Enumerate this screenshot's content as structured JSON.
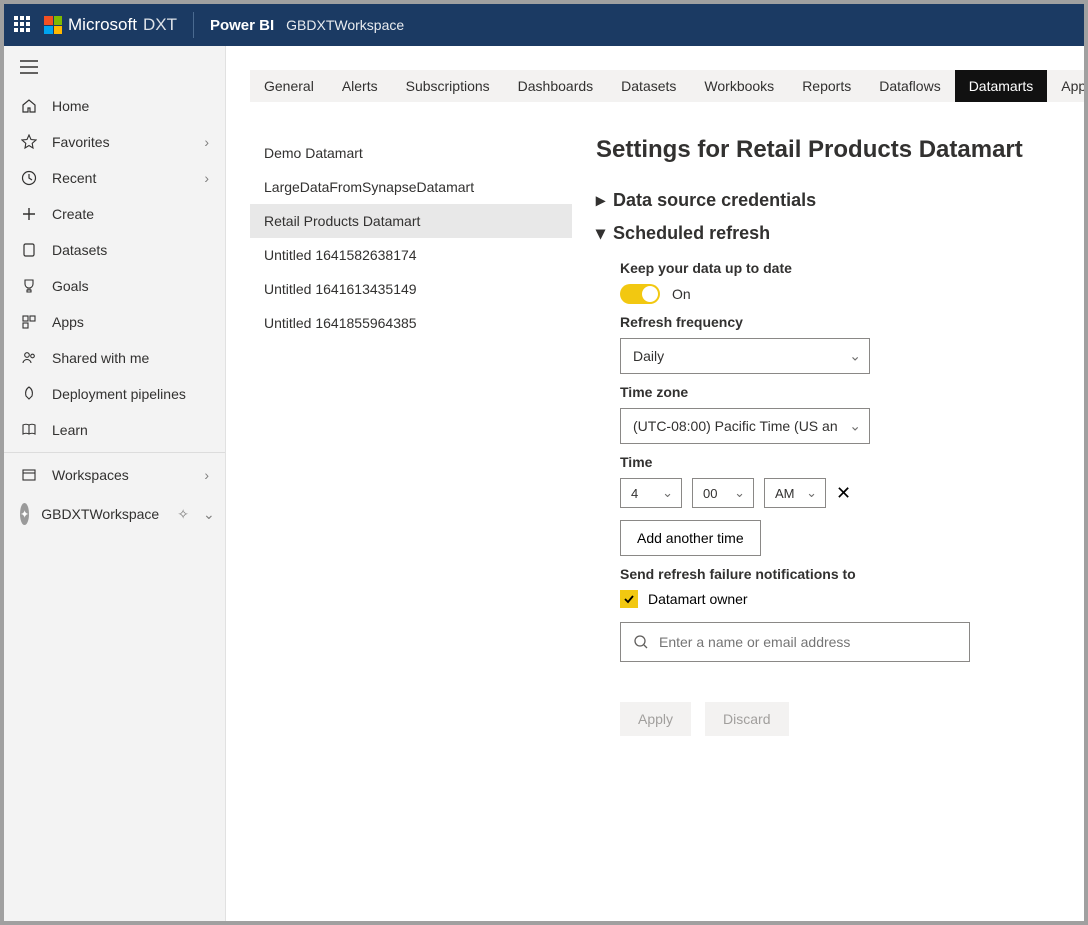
{
  "header": {
    "brand": "Microsoft",
    "brand_suffix": "DXT",
    "app": "Power BI",
    "workspace": "GBDXTWorkspace"
  },
  "sidebar": {
    "items": [
      {
        "label": "Home",
        "icon": "home-icon",
        "expandable": false
      },
      {
        "label": "Favorites",
        "icon": "star-icon",
        "expandable": true
      },
      {
        "label": "Recent",
        "icon": "clock-icon",
        "expandable": true
      },
      {
        "label": "Create",
        "icon": "plus-icon",
        "expandable": false
      },
      {
        "label": "Datasets",
        "icon": "database-icon",
        "expandable": false
      },
      {
        "label": "Goals",
        "icon": "trophy-icon",
        "expandable": false
      },
      {
        "label": "Apps",
        "icon": "apps-icon",
        "expandable": false
      },
      {
        "label": "Shared with me",
        "icon": "people-icon",
        "expandable": false
      },
      {
        "label": "Deployment pipelines",
        "icon": "rocket-icon",
        "expandable": false
      },
      {
        "label": "Learn",
        "icon": "book-icon",
        "expandable": false
      }
    ],
    "workspaces_label": "Workspaces",
    "current_workspace": "GBDXTWorkspace"
  },
  "tabs": [
    {
      "label": "General"
    },
    {
      "label": "Alerts"
    },
    {
      "label": "Subscriptions"
    },
    {
      "label": "Dashboards"
    },
    {
      "label": "Datasets"
    },
    {
      "label": "Workbooks"
    },
    {
      "label": "Reports"
    },
    {
      "label": "Dataflows"
    },
    {
      "label": "Datamarts",
      "active": true
    },
    {
      "label": "App"
    }
  ],
  "datamarts": [
    {
      "label": "Demo Datamart"
    },
    {
      "label": "LargeDataFromSynapseDatamart"
    },
    {
      "label": "Retail Products Datamart",
      "selected": true
    },
    {
      "label": "Untitled 1641582638174"
    },
    {
      "label": "Untitled 1641613435149"
    },
    {
      "label": "Untitled 1641855964385"
    }
  ],
  "settings": {
    "title": "Settings for Retail Products Datamart",
    "sections": {
      "credentials": {
        "label": "Data source credentials",
        "expanded": false
      },
      "scheduled": {
        "label": "Scheduled refresh",
        "expanded": true
      }
    },
    "scheduled": {
      "keep_label": "Keep your data up to date",
      "toggle_on_label": "On",
      "frequency_label": "Refresh frequency",
      "frequency_value": "Daily",
      "timezone_label": "Time zone",
      "timezone_value": "(UTC-08:00) Pacific Time (US an",
      "time_label": "Time",
      "time_hour": "4",
      "time_minute": "00",
      "time_ampm": "AM",
      "add_time_label": "Add another time",
      "notify_label": "Send refresh failure notifications to",
      "notify_owner_label": "Datamart owner",
      "search_placeholder": "Enter a name or email address",
      "apply_label": "Apply",
      "discard_label": "Discard"
    }
  }
}
